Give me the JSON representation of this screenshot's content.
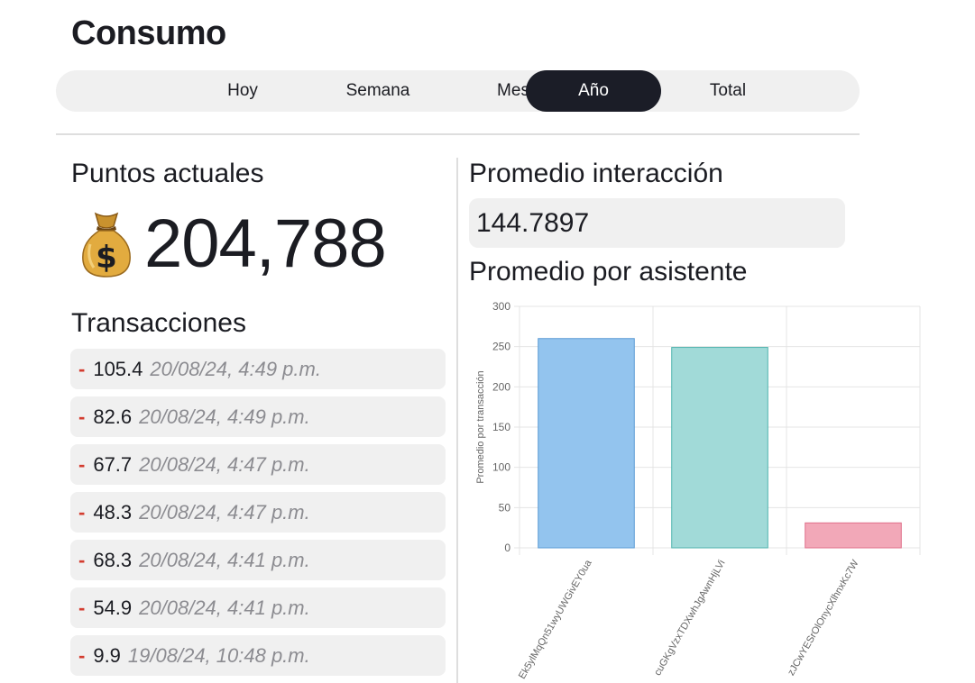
{
  "header": {
    "title": "Consumo"
  },
  "tabs": [
    {
      "label": "Hoy",
      "active": false
    },
    {
      "label": "Semana",
      "active": false
    },
    {
      "label": "Mes",
      "active": false
    },
    {
      "label": "Año",
      "active": true
    },
    {
      "label": "Total",
      "active": false
    }
  ],
  "points": {
    "title": "Puntos actuales",
    "icon": "money-bag-icon",
    "value": "204,788"
  },
  "transactions": {
    "title": "Transacciones",
    "items": [
      {
        "sign": "-",
        "amount": "105.4",
        "date": "20/08/24, 4:49 p.m."
      },
      {
        "sign": "-",
        "amount": "82.6",
        "date": "20/08/24, 4:49 p.m."
      },
      {
        "sign": "-",
        "amount": "67.7",
        "date": "20/08/24, 4:47 p.m."
      },
      {
        "sign": "-",
        "amount": "48.3",
        "date": "20/08/24, 4:47 p.m."
      },
      {
        "sign": "-",
        "amount": "68.3",
        "date": "20/08/24, 4:41 p.m."
      },
      {
        "sign": "-",
        "amount": "54.9",
        "date": "20/08/24, 4:41 p.m."
      },
      {
        "sign": "-",
        "amount": "9.9",
        "date": "19/08/24, 10:48 p.m."
      }
    ]
  },
  "interaction": {
    "title": "Promedio interacción",
    "value": "144.7897"
  },
  "assistant_average": {
    "title": "Promedio por asistente"
  },
  "colors": {
    "active_tab": "#1b1d27",
    "negative_sign": "#d33c2f",
    "bar_1": "#93c4ee",
    "bar_2": "#a1dad8",
    "bar_3": "#f2a8b8"
  },
  "chart_data": {
    "type": "bar",
    "categories": [
      "Ek5ylMqQn51wyUWGivEY0ua",
      "cuGKgVzxTDXwhJgAwnHjLVi",
      "zJCwYESrOlOnycXlhnxKc7W"
    ],
    "values": [
      260,
      249,
      31
    ],
    "ylabel": "Promedio por transacción",
    "ylim": [
      0,
      300
    ],
    "yticks": [
      "0",
      "50",
      "100",
      "150",
      "200",
      "250",
      "300"
    ],
    "grid": true,
    "legend": "none"
  }
}
